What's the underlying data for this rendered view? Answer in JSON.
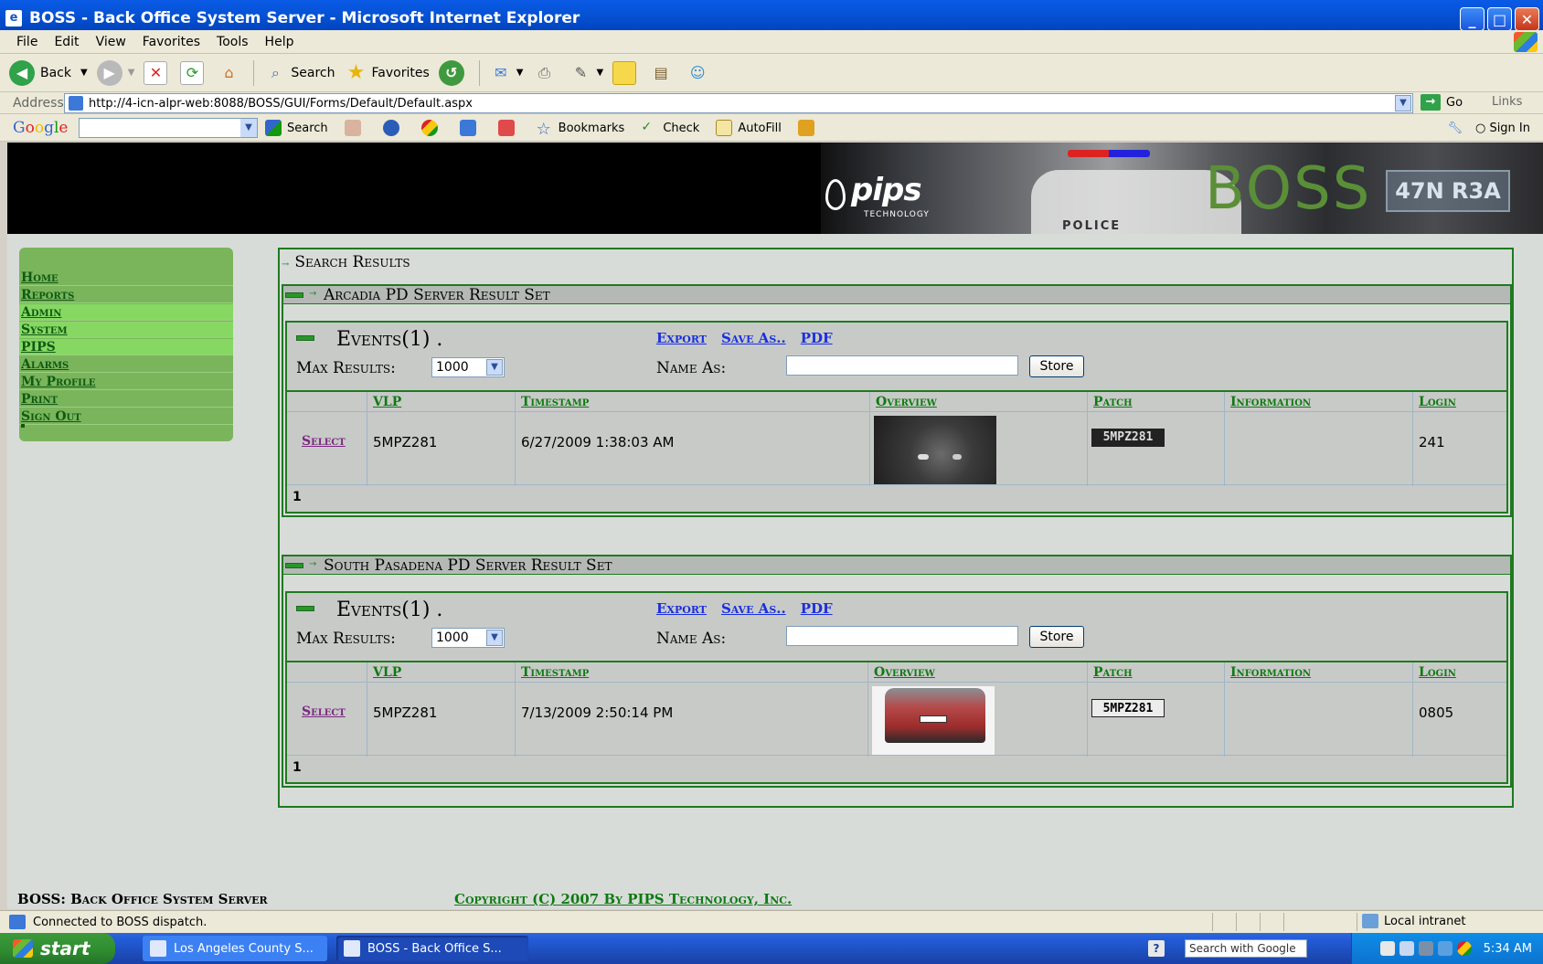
{
  "window": {
    "title": "BOSS - Back Office System Server - Microsoft Internet Explorer",
    "menu": [
      "File",
      "Edit",
      "View",
      "Favorites",
      "Tools",
      "Help"
    ]
  },
  "toolbar": {
    "back": "Back",
    "search": "Search",
    "favorites": "Favorites"
  },
  "address": {
    "label": "Address",
    "url": "http://4-icn-alpr-web:8088/BOSS/GUI/Forms/Default/Default.aspx",
    "go": "Go",
    "links": "Links"
  },
  "googlebar": {
    "logo": [
      "G",
      "o",
      "o",
      "g",
      "l",
      "e"
    ],
    "search": "Search",
    "bookmarks": "Bookmarks",
    "check": "Check",
    "autofill": "AutoFill",
    "signin": "Sign In"
  },
  "banner": {
    "brand": "pips",
    "brand_sub": "TECHNOLOGY",
    "product": "BOSS",
    "plate": "47N R3A",
    "car_text": "POLICE"
  },
  "sidebar": {
    "items": [
      "Home",
      "Reports",
      "Admin",
      "System",
      "PIPS",
      "Alarms",
      "My Profile",
      "Print",
      "Sign Out"
    ]
  },
  "main": {
    "title": "Search Results",
    "result_sets": [
      {
        "title": "Arcadia PD Server Result Set",
        "events_title": "Events(1) .",
        "links": [
          "Export",
          "Save As..",
          "PDF"
        ],
        "max_results_label": "Max Results:",
        "max_results_value": "1000",
        "name_as_label": "Name As:",
        "name_as_value": "",
        "store_label": "Store",
        "columns": [
          "VLP",
          "Timestamp",
          "Overview",
          "Patch",
          "Information",
          "Login"
        ],
        "rows": [
          {
            "select": "Select",
            "vlp": "5MPZ281",
            "timestamp": "6/27/2009 1:38:03 AM",
            "patch": "5MPZ281",
            "information": "",
            "login": "241"
          }
        ],
        "page": "1"
      },
      {
        "title": "South Pasadena PD Server Result Set",
        "events_title": "Events(1) .",
        "links": [
          "Export",
          "Save As..",
          "PDF"
        ],
        "max_results_label": "Max Results:",
        "max_results_value": "1000",
        "name_as_label": "Name As:",
        "name_as_value": "",
        "store_label": "Store",
        "columns": [
          "VLP",
          "Timestamp",
          "Overview",
          "Patch",
          "Information",
          "Login"
        ],
        "rows": [
          {
            "select": "Select",
            "vlp": "5MPZ281",
            "timestamp": "7/13/2009 2:50:14 PM",
            "patch": "5MPZ281",
            "information": "",
            "login": "0805"
          }
        ],
        "page": "1"
      }
    ]
  },
  "footer": {
    "left": "BOSS: Back Office System Server",
    "right": "Copyright (C) 2007 By PIPS Technology, Inc."
  },
  "status": {
    "text": "Connected to BOSS dispatch.",
    "zone": "Local intranet"
  },
  "taskbar": {
    "start": "start",
    "tasks": [
      "Los Angeles County S...",
      "BOSS - Back Office S..."
    ],
    "search_placeholder": "Search with Google",
    "clock": "5:34 AM"
  },
  "colors": {
    "accent_green": "#1f7a1f",
    "link_blue": "#1a2ee0",
    "sidebar_green": "#7ab55c",
    "boss_green": "#5a8f38"
  }
}
